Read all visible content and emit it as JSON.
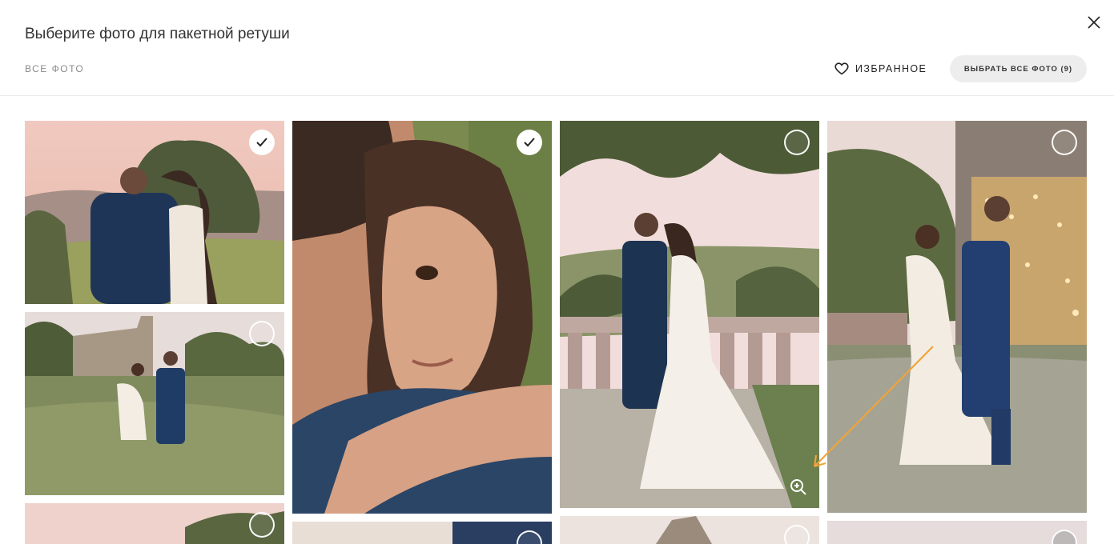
{
  "header": {
    "title": "Выберите фото для пакетной ретуши",
    "tab_all": "ВСЕ ФОТО",
    "favorites_label": "ИЗБРАННОЕ",
    "select_all_label": "ВЫБРАТЬ ВСЕ ФОТО (9)"
  },
  "photos": [
    {
      "id": 1,
      "description": "couple back view at sunset",
      "selected": true
    },
    {
      "id": 2,
      "description": "close-up couple embrace",
      "selected": true
    },
    {
      "id": 3,
      "description": "couple kissing at balustrade",
      "selected": false
    },
    {
      "id": 4,
      "description": "couple walking with string lights",
      "selected": false
    },
    {
      "id": 5,
      "description": "couple walking by stone castle",
      "selected": false
    },
    {
      "id": 6,
      "description": "photo",
      "selected": false
    },
    {
      "id": 7,
      "description": "photo",
      "selected": false
    },
    {
      "id": 8,
      "description": "photo",
      "selected": false
    },
    {
      "id": 9,
      "description": "photo",
      "selected": false
    }
  ],
  "colors": {
    "header_border": "#ececec",
    "button_bg": "#ededed",
    "annotation_arrow": "#f0a43a"
  }
}
